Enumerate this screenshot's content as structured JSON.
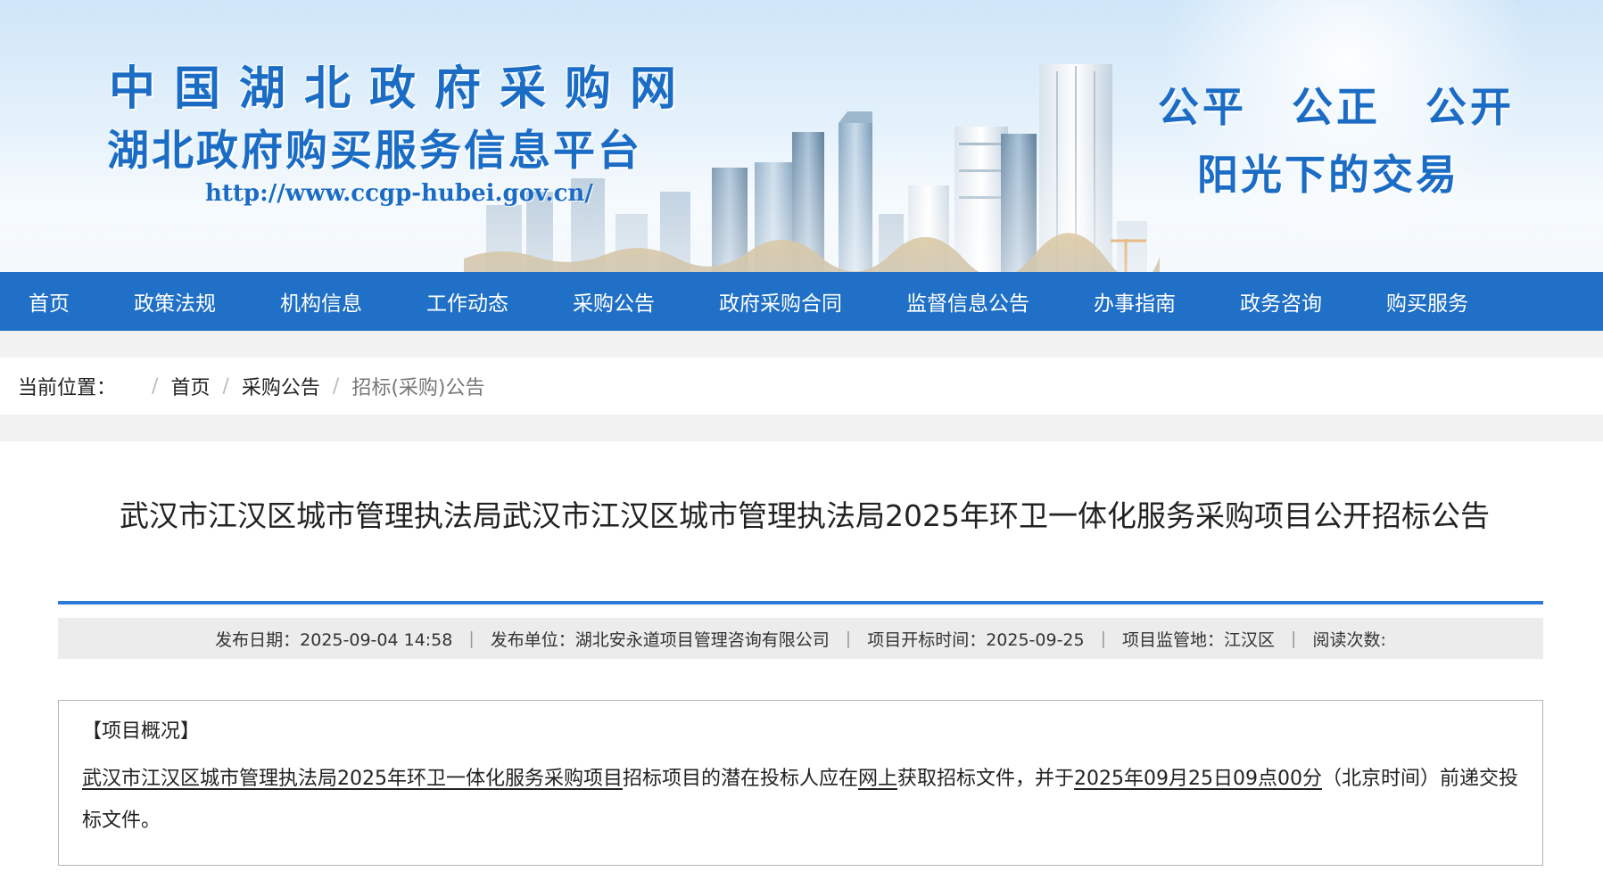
{
  "banner": {
    "title": "中国湖北政府采购网",
    "subtitle": "湖北政府购买服务信息平台",
    "url": "http://www.ccgp-hubei.gov.cn/",
    "slogan_line1": "公平 公正 公开",
    "slogan_line2": "阳光下的交易"
  },
  "nav": {
    "items": [
      "首页",
      "政策法规",
      "机构信息",
      "工作动态",
      "采购公告",
      "政府采购合同",
      "监督信息公告",
      "办事指南",
      "政务咨询",
      "购买服务"
    ]
  },
  "breadcrumb": {
    "label": "当前位置：",
    "items": [
      "首页",
      "采购公告",
      "招标(采购)公告"
    ]
  },
  "article": {
    "title": "武汉市江汉区城市管理执法局武汉市江汉区城市管理执法局2025年环卫一体化服务采购项目公开招标公告",
    "meta": {
      "publish_date": "发布日期：2025-09-04 14:58",
      "publisher": "发布单位：湖北安永道项目管理咨询有限公司",
      "open_date": "项目开标时间：2025-09-25",
      "region": "项目监管地：江汉区",
      "reads": "阅读次数:"
    },
    "summary": {
      "heading": "【项目概况】",
      "part1": "武汉市江汉区城市管理执法局2025年环卫一体化服务采购项目",
      "part2": "招标项目的潜在投标人应在",
      "part3": "网上",
      "part4": "获取招标文件，并于",
      "part5": "2025年09月25日09点00分",
      "part6": "（北京时间）前递交投标文件。"
    }
  },
  "colors": {
    "nav_bg": "#1f70c6",
    "brand_blue": "#1a6cc5",
    "rule_blue": "#2d7ad6"
  }
}
